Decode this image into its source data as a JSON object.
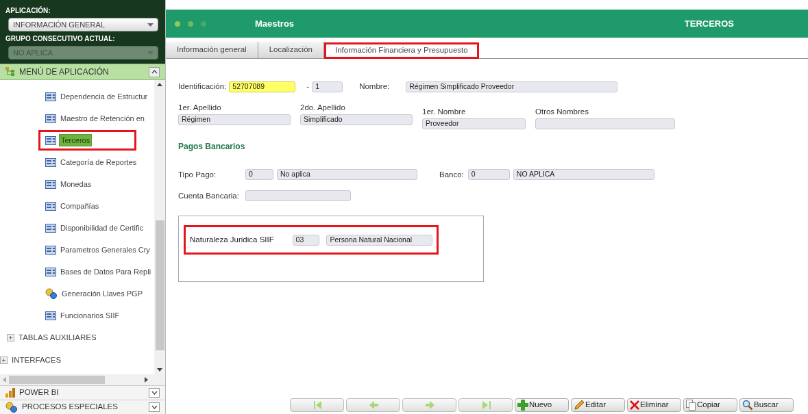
{
  "sidebar": {
    "application_label": "APLICACIÓN:",
    "application_select": {
      "value": "INFORMACIÓN GENERAL",
      "disabled": false
    },
    "group_label": "GRUPO CONSECUTIVO ACTUAL:",
    "group_select": {
      "value": "NO APLICA",
      "disabled": true
    },
    "menu_header": {
      "label": "MENÚ DE APLICACIÓN",
      "expanded": true
    },
    "tree": [
      {
        "children": [
          {
            "children": [
              {
                "label": "Dependencia de Estructur",
                "kind": "form",
                "selected": false,
                "highlighted": false
              },
              {
                "label": "Maestro de Retención en",
                "kind": "form",
                "selected": false,
                "highlighted": false
              },
              {
                "label": "Terceros",
                "kind": "form",
                "selected": true,
                "highlighted": true
              },
              {
                "label": "Categoría de Reportes",
                "kind": "form",
                "selected": false,
                "highlighted": false
              },
              {
                "label": "Monedas",
                "kind": "form",
                "selected": false,
                "highlighted": false
              },
              {
                "label": "Compañías",
                "kind": "form",
                "selected": false,
                "highlighted": false
              },
              {
                "label": "Disponibilidad de Certific",
                "kind": "form",
                "selected": false,
                "highlighted": false
              },
              {
                "label": "Parametros Generales Cry",
                "kind": "form",
                "selected": false,
                "highlighted": false
              },
              {
                "label": "Bases de Datos Para Repli",
                "kind": "form",
                "selected": false,
                "highlighted": false
              },
              {
                "label": "Generación Llaves PGP",
                "kind": "key",
                "selected": false,
                "highlighted": false
              },
              {
                "label": "Funcionarios SIIF",
                "kind": "form",
                "selected": false,
                "highlighted": false
              }
            ]
          },
          {
            "label": "TABLAS AUXILIARES",
            "expanded": false
          }
        ]
      },
      {
        "label": "INTERFACES",
        "expanded": false
      }
    ],
    "sections": [
      {
        "label": "POWER BI",
        "kind": "chart",
        "expanded": false
      },
      {
        "label": "PROCESOS ESPECIALES",
        "kind": "key",
        "expanded": false
      }
    ]
  },
  "header": {
    "title": "Maestros",
    "entity": "TERCEROS"
  },
  "tabs": [
    {
      "label": "Información general",
      "selected": false,
      "highlighted": false
    },
    {
      "label": "Localización",
      "selected": false,
      "highlighted": false
    },
    {
      "label": "Información Financiera y Presupuesto",
      "selected": true,
      "highlighted": true
    }
  ],
  "form": {
    "identificacion": {
      "label": "Identificación:",
      "value": "52707089",
      "focused": true
    },
    "separator": "-",
    "digito": {
      "value": "1"
    },
    "nombre": {
      "label": "Nombre:",
      "value": "Régimen Simplificado Proveedor"
    },
    "names": [
      {
        "label": "1er. Apellido",
        "value": "Régimen"
      },
      {
        "label": "2do. Apellido",
        "value": "Simplificado"
      },
      {
        "label": "1er. Nombre",
        "value": "Proveedor"
      },
      {
        "label": "Otros Nombres"
      }
    ],
    "section_title": "Pagos Bancarios",
    "tipo_pago": {
      "label": "Tipo Pago:",
      "code": "0",
      "value": "No aplica"
    },
    "banco": {
      "label": "Banco:",
      "code": "0",
      "value": "NO APLICA"
    },
    "cuenta": {
      "label": "Cuenta Bancaria:"
    },
    "naturaleza": {
      "label": "Naturaleza Juridica SIIF",
      "code": "03",
      "value": "Persona Natural Nacional",
      "highlighted": true
    }
  },
  "toolbar": {
    "nav": [
      {
        "kind": "first",
        "disabled": true
      },
      {
        "kind": "prev",
        "disabled": true
      },
      {
        "kind": "next",
        "disabled": true
      },
      {
        "kind": "last",
        "disabled": true
      }
    ],
    "actions": [
      {
        "label": "Nuevo",
        "kind": "new"
      },
      {
        "label": "Editar",
        "kind": "edit"
      },
      {
        "label": "Eliminar",
        "kind": "delete"
      },
      {
        "label": "Copiar",
        "kind": "copy"
      },
      {
        "label": "Buscar",
        "kind": "search"
      }
    ]
  }
}
